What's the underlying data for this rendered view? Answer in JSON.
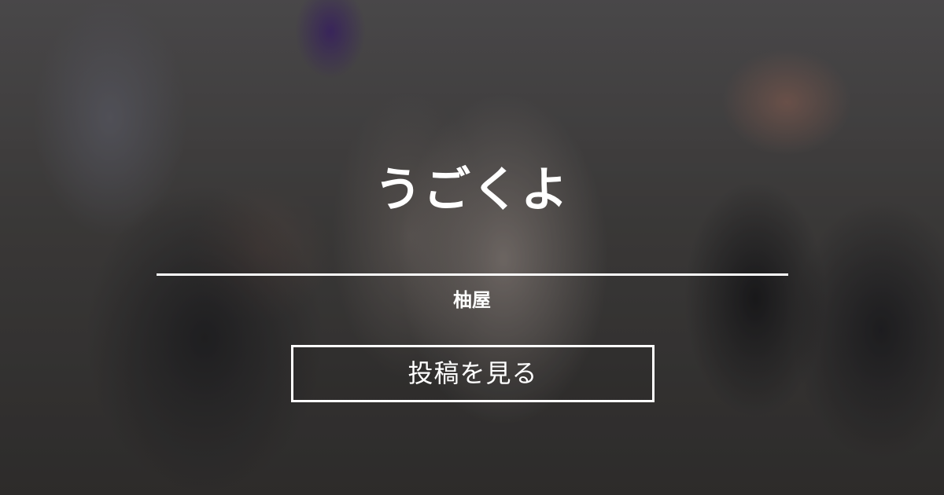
{
  "card": {
    "title": "うごくよ",
    "author": "柚屋",
    "cta_label": "投稿を見る"
  },
  "background": {
    "description_color_dominant": "#4a4847",
    "accent_purple": "#46287a"
  }
}
